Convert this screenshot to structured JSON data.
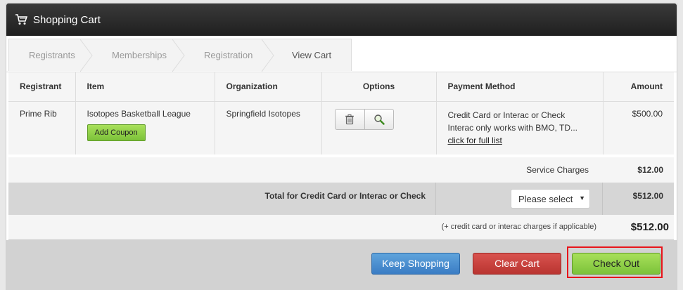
{
  "header": {
    "title": "Shopping Cart",
    "icon": "cart-icon"
  },
  "breadcrumb": [
    "Registrants",
    "Memberships",
    "Registration",
    "View Cart"
  ],
  "table": {
    "columns": [
      "Registrant",
      "Item",
      "Organization",
      "Options",
      "Payment Method",
      "Amount"
    ],
    "row": {
      "registrant": "Prime Rib",
      "item": "Isotopes Basketball League",
      "coupon_label": "Add Coupon",
      "organization": "Springfield Isotopes",
      "payment_line1": "Credit Card or Interac or Check",
      "payment_line2": "Interac only works with BMO, TD...",
      "payment_link": "click for full list",
      "amount": "$500.00"
    }
  },
  "service": {
    "label": "Service Charges",
    "amount": "$12.00"
  },
  "total": {
    "label": "Total for Credit Card or Interac or Check",
    "select_value": "Please select",
    "amount": "$512.00"
  },
  "grand": {
    "note": "(+ credit card or interac charges if applicable)",
    "amount": "$512.00"
  },
  "buttons": {
    "keep_shopping": "Keep Shopping",
    "clear_cart": "Clear Cart",
    "check_out": "Check Out"
  },
  "colors": {
    "accent_green": "#7cc23a",
    "blue": "#3a7cc4",
    "red": "#b93430",
    "highlight": "#e8141a"
  }
}
